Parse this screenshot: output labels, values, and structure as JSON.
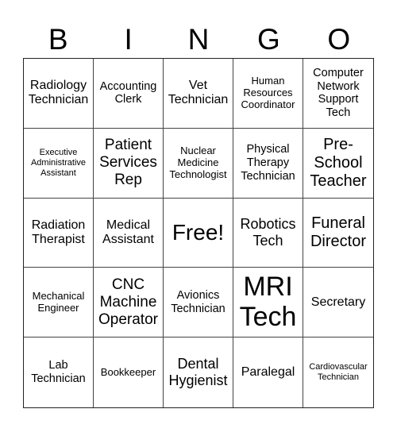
{
  "header": {
    "letters": [
      "B",
      "I",
      "N",
      "G",
      "O"
    ]
  },
  "cells": [
    "Radiology Technician",
    "Accounting Clerk",
    "Vet Technician",
    "Human Resources Coordinator",
    "Computer Network Support Tech",
    "Executive Administrative Assistant",
    "Patient Services Rep",
    "Nuclear Medicine Technologist",
    "Physical Therapy Technician",
    "Pre-School Teacher",
    "Radiation Therapist",
    "Medical Assistant",
    "Free!",
    "Robotics Tech",
    "Funeral Director",
    "Mechanical Engineer",
    "CNC Machine Operator",
    "Avionics Technician",
    "MRI Tech",
    "Secretary",
    "Lab Technician",
    "Bookkeeper",
    "Dental Hygienist",
    "Paralegal",
    "Cardiovascular Technician"
  ]
}
